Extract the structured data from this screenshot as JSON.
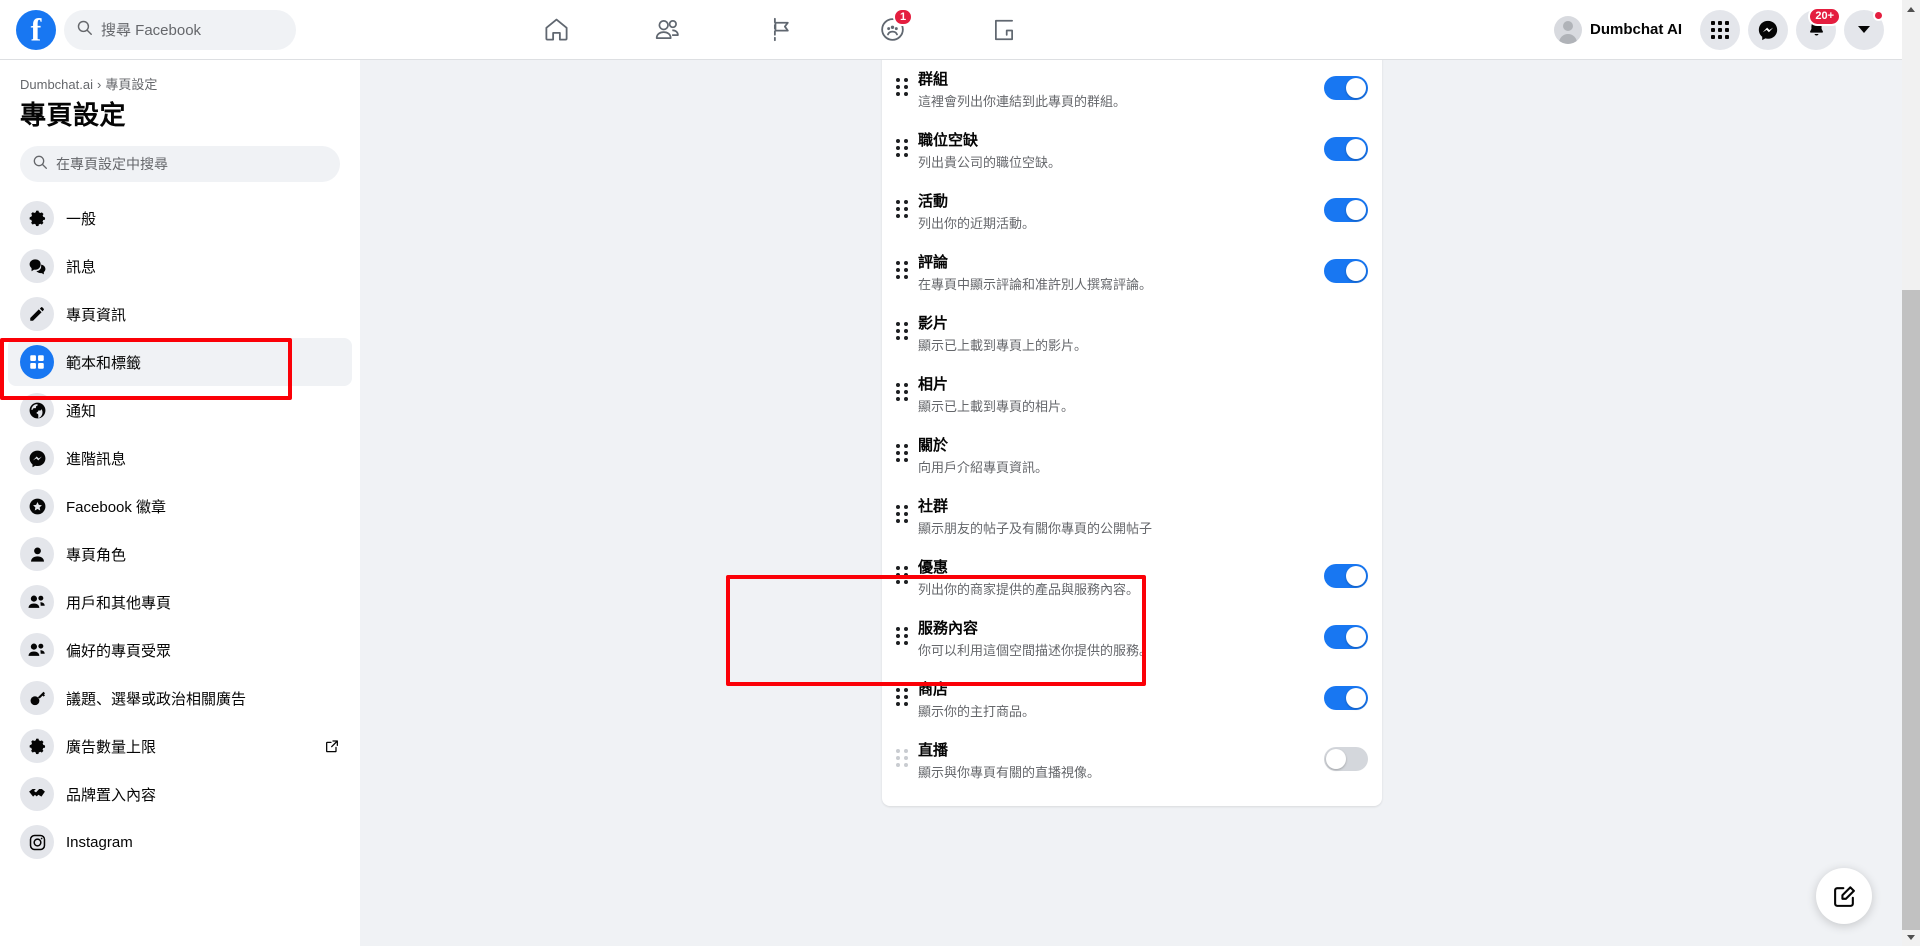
{
  "topbar": {
    "logo_icon": "facebook-logo-icon",
    "search": {
      "icon": "search-icon",
      "placeholder": "搜尋 Facebook",
      "value": ""
    },
    "nav_tabs": [
      {
        "name": "home",
        "icon": "home-icon",
        "badge": ""
      },
      {
        "name": "friends",
        "icon": "friends-icon",
        "badge": ""
      },
      {
        "name": "pages",
        "icon": "flag-icon",
        "badge": ""
      },
      {
        "name": "groups",
        "icon": "groups-icon",
        "badge": "1"
      },
      {
        "name": "gaming",
        "icon": "gaming-icon",
        "badge": ""
      }
    ],
    "account": {
      "name": "Dumbchat AI",
      "avatar_icon": "avatar-icon"
    },
    "actions": [
      {
        "name": "menu",
        "icon": "grid-menu-icon",
        "badge": ""
      },
      {
        "name": "messenger",
        "icon": "messenger-icon",
        "badge": ""
      },
      {
        "name": "notifications",
        "icon": "bell-icon",
        "badge": "20+"
      },
      {
        "name": "account-menu",
        "icon": "chevron-down-icon",
        "badge": "dot"
      }
    ]
  },
  "sidebar": {
    "breadcrumb": {
      "parent": "Dumbchat.ai",
      "separator": "›",
      "current": "專頁設定"
    },
    "title": "專頁設定",
    "search": {
      "icon": "search-icon",
      "placeholder": "在專頁設定中搜尋",
      "value": ""
    },
    "items": [
      {
        "label": "一般",
        "icon": "gear-icon",
        "active": false,
        "external": false
      },
      {
        "label": "訊息",
        "icon": "chat-icon",
        "active": false,
        "external": false
      },
      {
        "label": "專頁資訊",
        "icon": "pencil-icon",
        "active": false,
        "external": false
      },
      {
        "label": "範本和標籤",
        "icon": "grid-squares-icon",
        "active": true,
        "external": false
      },
      {
        "label": "通知",
        "icon": "globe-icon",
        "active": false,
        "external": false
      },
      {
        "label": "進階訊息",
        "icon": "messenger-icon",
        "active": false,
        "external": false
      },
      {
        "label": "Facebook 徽章",
        "icon": "star-badge-icon",
        "active": false,
        "external": false
      },
      {
        "label": "專頁角色",
        "icon": "person-icon",
        "active": false,
        "external": false
      },
      {
        "label": "用戶和其他專頁",
        "icon": "people-icon",
        "active": false,
        "external": false
      },
      {
        "label": "偏好的專頁受眾",
        "icon": "people-icon",
        "active": false,
        "external": false
      },
      {
        "label": "議題、選舉或政治相關廣告",
        "icon": "key-icon",
        "active": false,
        "external": false
      },
      {
        "label": "廣告數量上限",
        "icon": "gear-icon",
        "active": false,
        "external": true
      },
      {
        "label": "品牌置入內容",
        "icon": "handshake-icon",
        "active": false,
        "external": false
      },
      {
        "label": "Instagram",
        "icon": "instagram-icon",
        "active": false,
        "external": false
      }
    ]
  },
  "main": {
    "tabs": [
      {
        "name": "群組",
        "desc": "這裡會列出你連結到此專頁的群組。",
        "toggle": "on",
        "handle": "normal",
        "highlighted": false
      },
      {
        "name": "職位空缺",
        "desc": "列出貴公司的職位空缺。",
        "toggle": "on",
        "handle": "normal",
        "highlighted": false
      },
      {
        "name": "活動",
        "desc": "列出你的近期活動。",
        "toggle": "on",
        "handle": "normal",
        "highlighted": false
      },
      {
        "name": "評論",
        "desc": "在專頁中顯示評論和准許別人撰寫評論。",
        "toggle": "on",
        "handle": "normal",
        "highlighted": false
      },
      {
        "name": "影片",
        "desc": "顯示已上載到專頁上的影片。",
        "toggle": "none",
        "handle": "normal",
        "highlighted": false
      },
      {
        "name": "相片",
        "desc": "顯示已上載到專頁的相片。",
        "toggle": "none",
        "handle": "normal",
        "highlighted": false
      },
      {
        "name": "關於",
        "desc": "向用戶介紹專頁資訊。",
        "toggle": "none",
        "handle": "normal",
        "highlighted": false
      },
      {
        "name": "社群",
        "desc": "顯示朋友的帖子及有關你專頁的公開帖子",
        "toggle": "none",
        "handle": "normal",
        "highlighted": false
      },
      {
        "name": "優惠",
        "desc": "列出你的商家提供的產品與服務內容。",
        "toggle": "on",
        "handle": "normal",
        "highlighted": false
      },
      {
        "name": "服務內容",
        "desc": "你可以利用這個空間描述你提供的服務。",
        "toggle": "on",
        "handle": "normal",
        "highlighted": true
      },
      {
        "name": "商店",
        "desc": "顯示你的主打商品。",
        "toggle": "on",
        "handle": "normal",
        "highlighted": true
      },
      {
        "name": "直播",
        "desc": "顯示與你專頁有關的直播視像。",
        "toggle": "off",
        "handle": "dim",
        "highlighted": false
      }
    ],
    "fab": {
      "icon": "compose-edit-icon"
    }
  },
  "annotations": {
    "color": "#fb0007",
    "boxes": [
      {
        "name": "sidebar-template-tabs-highlight",
        "target": "範本和標籤"
      },
      {
        "name": "services-shop-rows-highlight",
        "target": "服務內容 / 商店"
      }
    ]
  },
  "scrollbar": {
    "up_icon": "scroll-up-arrow-icon",
    "down_icon": "scroll-down-arrow-icon"
  }
}
